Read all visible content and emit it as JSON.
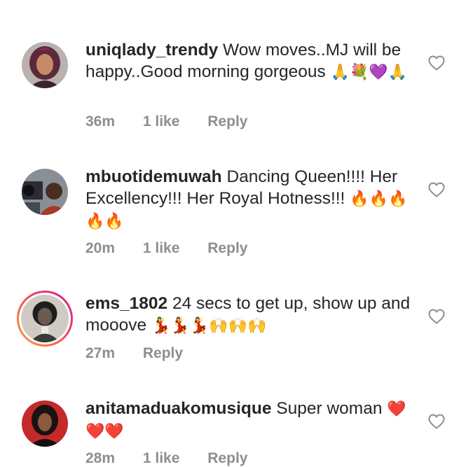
{
  "comments": [
    {
      "username": "uniqlady_trendy",
      "text": "Wow moves..MJ will be happy..Good morning gorgeous",
      "emoji": "🙏💐💜🙏",
      "time": "36m",
      "likes": "1 like",
      "reply_label": "Reply",
      "avatar_icon": "woman-portrait-icon"
    },
    {
      "username": "mbuotidemuwah",
      "text": "Dancing Queen!!!! Her Excellency!!! Her Royal Hotness!!!",
      "emoji": "🔥🔥🔥🔥🔥",
      "time": "20m",
      "likes": "1 like",
      "reply_label": "Reply",
      "avatar_icon": "camera-crew-portrait-icon"
    },
    {
      "username": "ems_1802",
      "text": "24 secs to get up, show up and mooove",
      "emoji": "💃💃💃🙌🙌🙌",
      "time": "27m",
      "likes": "",
      "reply_label": "Reply",
      "avatar_icon": "vintage-portrait-icon"
    },
    {
      "username": "anitamaduakomusique",
      "text": "Super woman",
      "emoji": "❤️❤️❤️",
      "time": "28m",
      "likes": "1 like",
      "reply_label": "Reply",
      "avatar_icon": "singer-portrait-icon"
    }
  ],
  "colors": {
    "text": "#262626",
    "meta": "#8e8e8e",
    "story_ring": "#e8327a"
  }
}
